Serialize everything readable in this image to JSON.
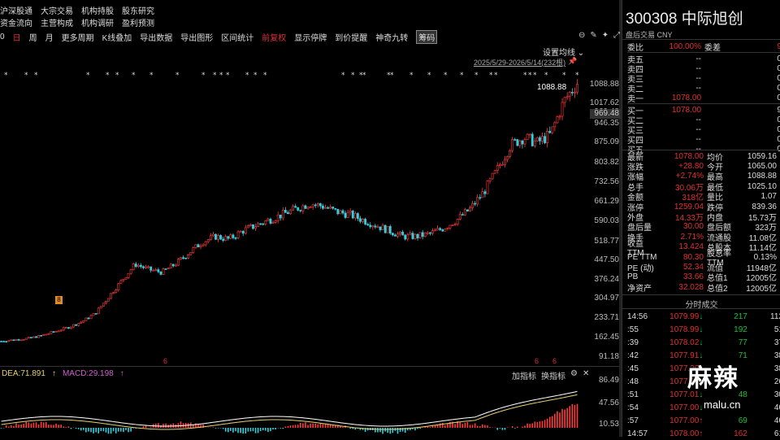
{
  "top_menu": {
    "row1": [
      "沪深股通",
      "大宗交易",
      "机构持股",
      "股东研究"
    ],
    "row2": [
      "资金流向",
      "主营构成",
      "机构调研",
      "盈利预测"
    ]
  },
  "toolbar": {
    "items": [
      "0",
      "日",
      "周",
      "月",
      "更多周期",
      "K线叠加",
      "导出数据",
      "导出图形",
      "区间统计",
      "前复权",
      "显示停牌",
      "到价提醒",
      "神奇九转",
      "筹码"
    ],
    "active": "前复权",
    "boxed": "筹码"
  },
  "chart_header": {
    "ma_setting": "设置均线",
    "date_range": "2025/5/29-2026/5/14(232根)"
  },
  "price_axis": [
    "1088.88",
    "1017.62",
    "969.48",
    "946.35",
    "875.09",
    "803.82",
    "732.56",
    "661.29",
    "590.03",
    "518.77",
    "447.50",
    "376.24",
    "304.97",
    "233.71",
    "162.45",
    "91.18"
  ],
  "price_tag": "1088.88",
  "markers": {
    "bottom_marker": "6",
    "left_marker": "8"
  },
  "indicator": {
    "dea": "DEA:71.891",
    "macd": "MACD:29.198",
    "buttons": [
      "加指标",
      "换指标"
    ],
    "axis": [
      "86.49",
      "47.56",
      "10.53"
    ]
  },
  "chart_data": {
    "type": "candlestick",
    "x_range": [
      "2025/5/29",
      "2026/5/14"
    ],
    "bars": 232,
    "price_axis_ticks": [
      1088.88,
      1017.62,
      969.48,
      946.35,
      875.09,
      803.82,
      732.56,
      661.29,
      590.03,
      518.77,
      447.5,
      376.24,
      304.97,
      233.71,
      162.45,
      91.18
    ],
    "approx_close_trend": [
      140,
      145,
      150,
      160,
      175,
      190,
      210,
      240,
      300,
      360,
      420,
      400,
      390,
      420,
      460,
      500,
      520,
      510,
      540,
      560,
      580,
      600,
      620,
      640,
      630,
      610,
      600,
      580,
      560,
      540,
      520,
      520,
      530,
      550,
      580,
      620,
      680,
      760,
      850,
      880,
      860,
      890,
      1010,
      1078
    ],
    "macd_axis": [
      86.49,
      47.56,
      10.53
    ]
  },
  "quote": {
    "code_name": "300308 中际旭创",
    "sub": "盘后交易 CNY",
    "weibi_label": "委比",
    "weibi": "100.00%",
    "weicha_label": "委差",
    "weicha": "9",
    "sell": [
      {
        "label": "卖五",
        "price": "--",
        "vol": "0"
      },
      {
        "label": "卖四",
        "price": "--",
        "vol": "0"
      },
      {
        "label": "卖三",
        "price": "--",
        "vol": "0"
      },
      {
        "label": "卖二",
        "price": "--",
        "vol": "0"
      },
      {
        "label": "卖一",
        "price": "1078.00",
        "vol": "0"
      }
    ],
    "buy": [
      {
        "label": "买一",
        "price": "1078.00",
        "vol": "9"
      },
      {
        "label": "买二",
        "price": "--",
        "vol": "0"
      },
      {
        "label": "买三",
        "price": "--",
        "vol": "0"
      },
      {
        "label": "买四",
        "price": "--",
        "vol": "0"
      },
      {
        "label": "买五",
        "price": "--",
        "vol": "0"
      }
    ],
    "stats": [
      {
        "l1": "最新",
        "v1": "1078.00",
        "c1": "red",
        "l2": "均价",
        "v2": "1059.16",
        "c2": "red"
      },
      {
        "l1": "涨跌",
        "v1": "+28.80",
        "c1": "red",
        "l2": "今开",
        "v2": "1065.00",
        "c2": "red"
      },
      {
        "l1": "涨幅",
        "v1": "+2.74%",
        "c1": "red",
        "l2": "最高",
        "v2": "1088.88",
        "c2": "red"
      },
      {
        "l1": "总手",
        "v1": "30.06万",
        "c1": "white",
        "l2": "最低",
        "v2": "1025.10",
        "c2": "green"
      },
      {
        "l1": "金额",
        "v1": "318亿",
        "c1": "red",
        "l2": "量比",
        "v2": "1.07",
        "c2": "white"
      },
      {
        "l1": "涨停",
        "v1": "1259.04",
        "c1": "red",
        "l2": "跌停",
        "v2": "839.36",
        "c2": "green"
      },
      {
        "l1": "外盘",
        "v1": "14.33万",
        "c1": "red",
        "l2": "内盘",
        "v2": "15.73万",
        "c2": "green"
      },
      {
        "l1": "盘后量",
        "v1": "30.00",
        "c1": "white",
        "l2": "盘后额",
        "v2": "323万",
        "c2": "red"
      },
      {
        "l1": "换手",
        "v1": "2.71%",
        "c1": "white",
        "l2": "流通股",
        "v2": "11.08亿",
        "c2": "white"
      },
      {
        "l1": "收益TTM",
        "v1": "13.424",
        "c1": "white",
        "l2": "总股本",
        "v2": "11.14亿",
        "c2": "white"
      },
      {
        "l1": "PE TTM",
        "v1": "80.30",
        "c1": "white",
        "l2": "股息率TTM",
        "v2": "0.13%",
        "c2": "white"
      },
      {
        "l1": "PE (动)",
        "v1": "52.34",
        "c1": "white",
        "l2": "流值",
        "v2": "11948亿",
        "c2": "white"
      },
      {
        "l1": "PB",
        "v1": "33.66",
        "c1": "white",
        "l2": "总值1",
        "v2": "12005亿",
        "c2": "white"
      },
      {
        "l1": "净资产",
        "v1": "32.028",
        "c1": "white",
        "l2": "总值2",
        "v2": "12005亿",
        "c2": "white"
      }
    ],
    "ticks_title": "分时成交",
    "ticks": [
      {
        "t": "14:56",
        "p": "1079.99",
        "dir": "down",
        "v": "217",
        "c": "green",
        "w": "112"
      },
      {
        "t": ":55",
        "p": "1078.99",
        "dir": "down",
        "v": "192",
        "c": "green",
        "w": "51"
      },
      {
        "t": ":39",
        "p": "1078.02",
        "dir": "down",
        "v": "77",
        "c": "green",
        "w": "37"
      },
      {
        "t": ":42",
        "p": "1077.91",
        "dir": "down",
        "v": "71",
        "c": "green",
        "w": "38"
      },
      {
        "t": ":45",
        "p": "1077.20",
        "dir": "up",
        "v": "",
        "c": "red",
        "w": "38"
      },
      {
        "t": ":48",
        "p": "1077.30",
        "dir": "up",
        "v": "",
        "c": "red",
        "w": "26"
      },
      {
        "t": ":51",
        "p": "1077.01",
        "dir": "down",
        "v": "48",
        "c": "green",
        "w": "30"
      },
      {
        "t": ":54",
        "p": "1077.00",
        "dir": "down",
        "v": "",
        "c": "green",
        "w": "46"
      },
      {
        "t": ":57",
        "p": "1077.00",
        "dir": "up",
        "v": "69",
        "c": "green",
        "w": "46"
      },
      {
        "t": "14:57",
        "p": "1078.00",
        "dir": "up",
        "v": "162",
        "c": "red",
        "w": "61"
      }
    ]
  },
  "watermark": {
    "text": "麻辣",
    "site": "malu.cn"
  }
}
